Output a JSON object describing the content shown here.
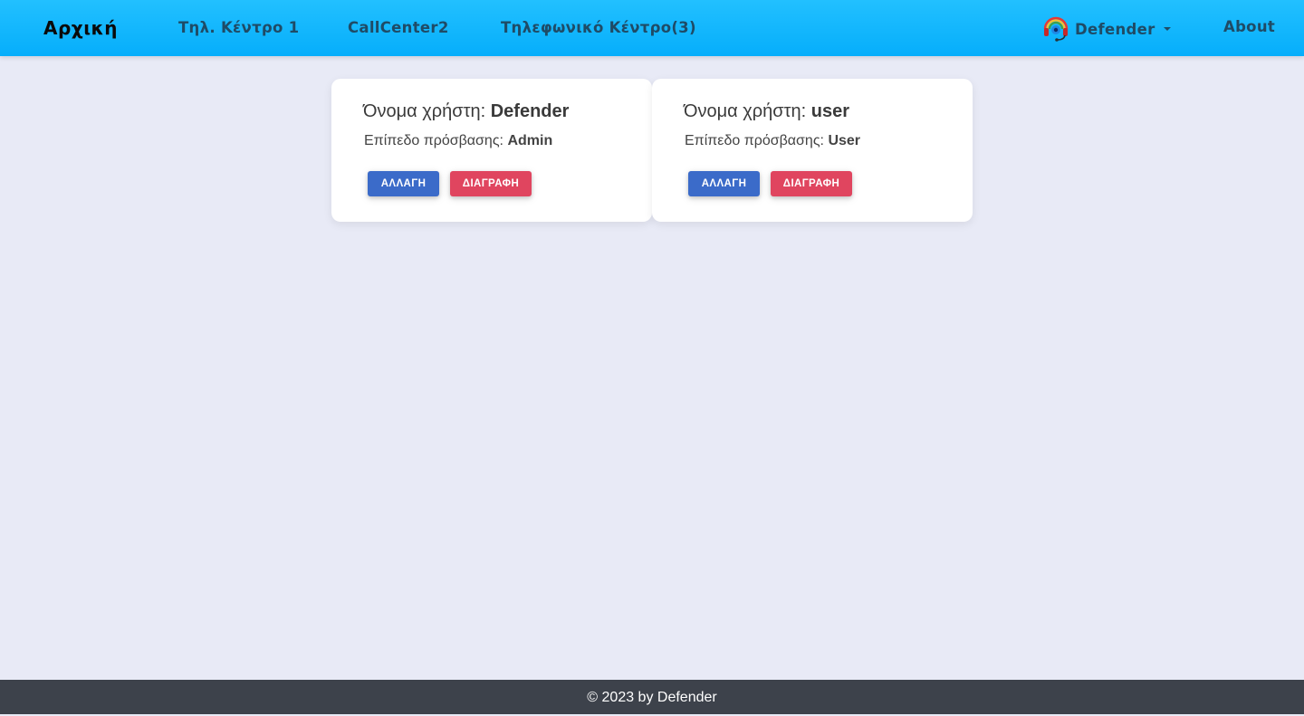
{
  "nav": {
    "brand": "Αρχική",
    "links": [
      "Τηλ. Κέντρο 1",
      "CallCenter2",
      "Τηλεφωνικό Κέντρο(3)"
    ],
    "user_menu": {
      "name": "Defender",
      "avatar_icon": "headset-avatar-icon"
    },
    "about": "About"
  },
  "cards": [
    {
      "title_prefix": "Όνομα χρήστη: ",
      "username": "Defender",
      "level_prefix": "Επίπεδο πρόσβασης: ",
      "level": "Admin",
      "edit_label": "ΑΛΛΑΓΗ",
      "delete_label": "ΔΙΑΓΡΑΦΗ"
    },
    {
      "title_prefix": "Όνομα χρήστη: ",
      "username": "user",
      "level_prefix": "Επίπεδο πρόσβασης: ",
      "level": "User",
      "edit_label": "ΑΛΛΑΓΗ",
      "delete_label": "ΔΙΑΓΡΑΦΗ"
    }
  ],
  "footer": {
    "text": "© 2023 by Defender"
  },
  "colors": {
    "navbar": "#0db2fd",
    "page_bg": "#e8eaf6",
    "edit_button": "#3b6bc9",
    "delete_button": "#e0455f",
    "footer_bg": "#3d424b"
  }
}
